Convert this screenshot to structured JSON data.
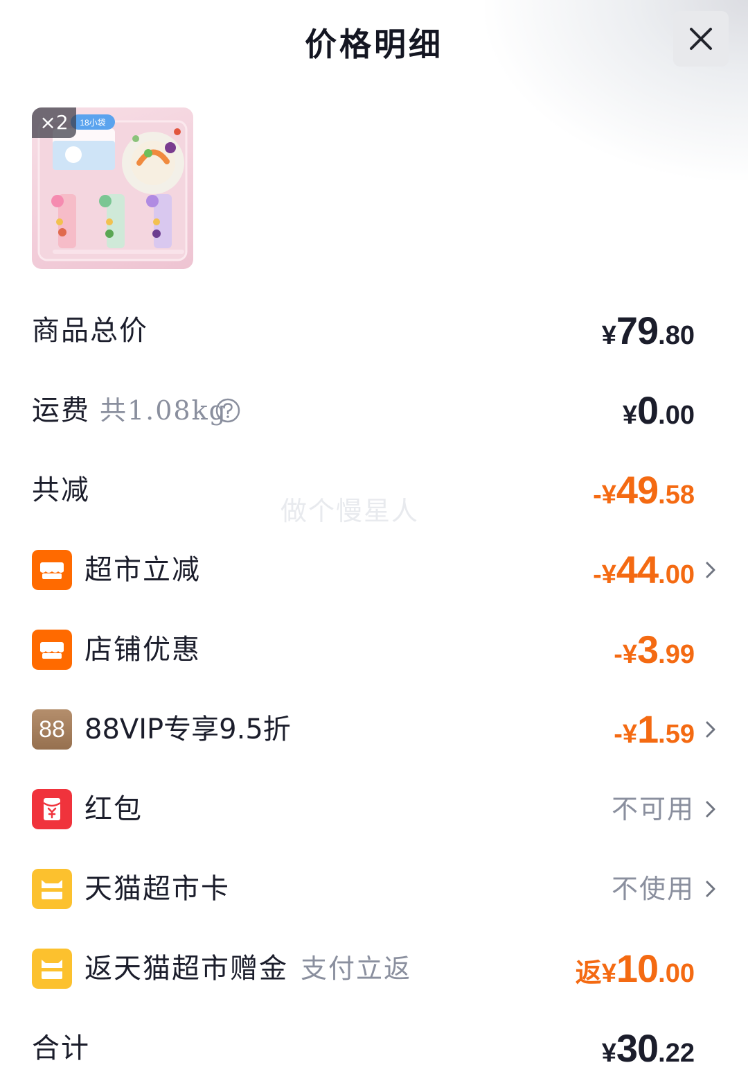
{
  "header": {
    "title": "价格明细"
  },
  "product": {
    "quantity": "×2",
    "pack_label": "18小袋"
  },
  "watermark": "做个慢星人",
  "rows": {
    "total_goods": {
      "label": "商品总价",
      "price": {
        "cur": "¥",
        "int": "79",
        "dec": ".80"
      }
    },
    "shipping": {
      "label": "运费",
      "note": "共1.08kg",
      "price": {
        "cur": "¥",
        "int": "0",
        "dec": ".00"
      }
    },
    "total_discount": {
      "label": "共减",
      "price": {
        "cur": "-¥",
        "int": "49",
        "dec": ".58"
      }
    },
    "market_discount": {
      "label": "超市立减",
      "price": {
        "cur": "-¥",
        "int": "44",
        "dec": ".00"
      }
    },
    "store_discount": {
      "label": "店铺优惠",
      "price": {
        "cur": "-¥",
        "int": "3",
        "dec": ".99"
      }
    },
    "vip_discount": {
      "badge": "88",
      "label": "88VIP专享9.5折",
      "price": {
        "cur": "-¥",
        "int": "1",
        "dec": ".59"
      }
    },
    "red_packet": {
      "label": "红包",
      "status": "不可用"
    },
    "market_card": {
      "label": "天猫超市卡",
      "status": "不使用"
    },
    "cashback": {
      "label": "返天猫超市赠金",
      "note": "支付立返",
      "price": {
        "cur": "返¥",
        "int": "10",
        "dec": ".00"
      }
    },
    "total": {
      "label": "合计",
      "price": {
        "cur": "¥",
        "int": "30",
        "dec": ".22"
      }
    }
  },
  "colors": {
    "accent_orange": "#f46a12",
    "badge_orange": "#ff6a00",
    "badge_red": "#f0333c",
    "badge_yellow": "#fcc12e",
    "badge_vip": "#a98160",
    "muted_text": "#8a8f9e"
  }
}
